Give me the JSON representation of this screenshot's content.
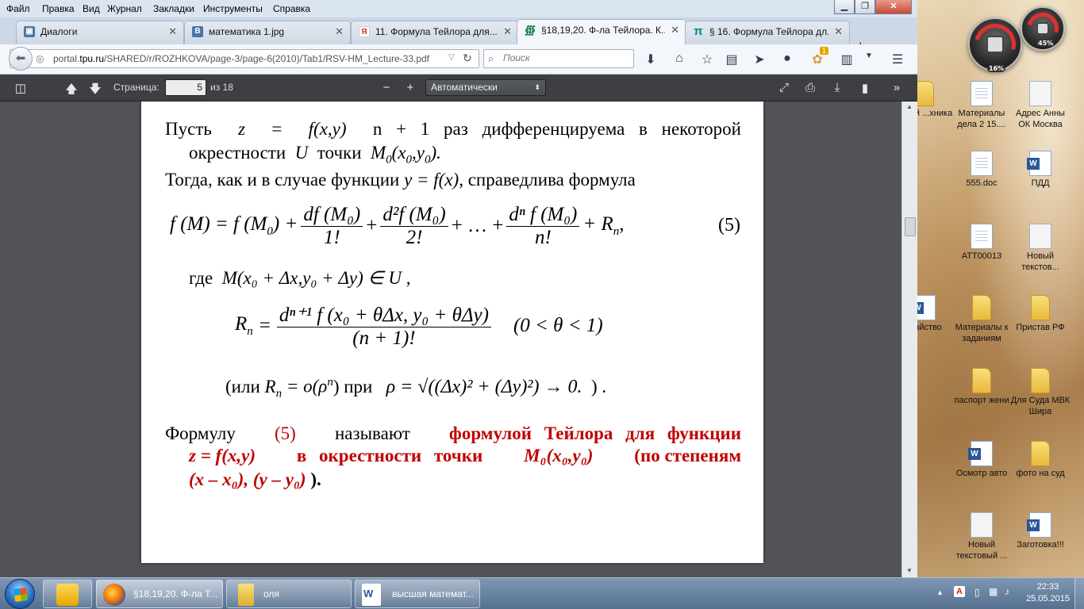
{
  "menu": [
    "Файл",
    "Правка",
    "Вид",
    "Журнал",
    "Закладки",
    "Инструменты",
    "Справка"
  ],
  "tabs": [
    {
      "label": "Диалоги",
      "icon": "vk-icon"
    },
    {
      "label": "математика 1.jpg",
      "icon": "vk-icon"
    },
    {
      "label": "11. Формула Тейлора для...",
      "icon": "yandex-icon"
    },
    {
      "label": "§18,19,20. Ф-ла Тейлора. К...",
      "icon": "tpu-icon",
      "active": true
    },
    {
      "label": "§ 16. Формула Тейлора дл...",
      "icon": "pi-icon"
    }
  ],
  "nav": {
    "url_prefix": "portal.",
    "url_domain": "tpu.ru",
    "url_rest": "/SHARED/r/ROZHKOVA/page-3/page-6(2010)/Tab1/RSV-HM_Lecture-33.pdf",
    "search_placeholder": "Поиск",
    "addon_badge": "1"
  },
  "pdf": {
    "page_label": "Страница:",
    "page_value": "5",
    "page_total": "из 18",
    "zoom": "Автоматически",
    "zoom_minus": "−",
    "zoom_plus": "+"
  },
  "document": {
    "l1a": "Пусть",
    "l1b": "z",
    "l1c": "=",
    "l1d": "f(x,y)",
    "l1e": "n + 1 раз дифференцируема в некоторой",
    "l2a": "окрестности",
    "l2b": "U",
    "l2c": "точки",
    "l2d": "M",
    "l2e": "0",
    "l2f": "(x",
    "l2g": "0",
    "l2h": ",y",
    "l2i": "0",
    "l2j": ").",
    "l3a": "Тогда, как и в случае функции",
    "l3b": "y = f(x)",
    "l3c": ", справедлива формула",
    "eq5_lhs": "f (M) = f (M",
    "eq5_lhs_sub": "0",
    "eq5_plus": ") +",
    "eq5_t1_num": "df (M₀)",
    "eq5_t1_den": "1!",
    "eq5_t2_num": "d²f (M₀)",
    "eq5_t2_den": "2!",
    "eq5_dots": "+ … +",
    "eq5_t3_num": "dⁿ f (M₀)",
    "eq5_t3_den": "n!",
    "eq5_rn": "+ R",
    "eq5_rn_sub": "n",
    "eq5_comma": ",",
    "eq5_number": "(5)",
    "where_a": "где",
    "where_b": "M(x₀ + Δx,y₀ + Δy) ∈ U ,",
    "rn_lhs": "R",
    "rn_lhs_sub": "n",
    "rn_eq": "=",
    "rn_num": "dⁿ⁺¹ f (x₀ + θΔx, y₀ + θΔy)",
    "rn_den": "(n + 1)!",
    "rn_cond": "(0 < θ < 1)",
    "or_a": "(или",
    "or_b": "R",
    "or_b_sub": "n",
    "or_c": "= o(ρ",
    "or_c_sup": "n",
    "or_d": ") при",
    "or_e": "ρ = √((Δx)² + (Δy)²) → 0.",
    "or_f": ") .",
    "f1a": "Формулу",
    "f1b": "(5)",
    "f1c": "называют",
    "f1d": "формулой Тейлора для функции",
    "f2a": "z = f(x,y)",
    "f2b": "в окрестности точки",
    "f2c": "M₀(x₀,y₀)",
    "f2d": "(по степеням",
    "f3a": "(x – x₀), (y – y₀)",
    "f3b": ")."
  },
  "desktop": {
    "gadget_cpu": "16%",
    "gadget_mem": "45%",
    "icons": [
      {
        "label": "...ный ...хника",
        "type": "folder"
      },
      {
        "label": "Материалы дела 2 15....",
        "type": "doc"
      },
      {
        "label": "Адрес Анны ОК Москва",
        "type": "note"
      },
      {
        "label": "555.doc",
        "type": "doc"
      },
      {
        "label": "ПДД",
        "type": "word"
      },
      {
        "label": "АТТ00013",
        "type": "doc"
      },
      {
        "label": "Новый текстов...",
        "type": "note"
      },
      {
        "label": "...айство",
        "type": "word"
      },
      {
        "label": "Материалы к заданиям",
        "type": "folder"
      },
      {
        "label": "Пристав РФ",
        "type": "folder"
      },
      {
        "label": "паспорт жени",
        "type": "folder"
      },
      {
        "label": "Для Суда МВК Шира",
        "type": "folder"
      },
      {
        "label": "Осмотр авто",
        "type": "word"
      },
      {
        "label": "фото на суд",
        "type": "folder"
      },
      {
        "label": "Новый текстовый ...",
        "type": "note"
      },
      {
        "label": "Заготовка!!!",
        "type": "word"
      }
    ]
  },
  "taskbar": {
    "items": [
      {
        "label": "",
        "icon": "outlook-icon"
      },
      {
        "label": "§18,19,20. Ф-ла Т...",
        "icon": "firefox-icon",
        "active": true
      },
      {
        "label": "оля",
        "icon": "folder-icon"
      },
      {
        "label": "высшая математ...",
        "icon": "word-icon"
      }
    ],
    "time": "22:33",
    "date": "25.05.2015"
  },
  "colors": {
    "accent_red": "#c00000",
    "pdf_toolbar": "#3d3f44",
    "viewer_bg": "#515357"
  }
}
